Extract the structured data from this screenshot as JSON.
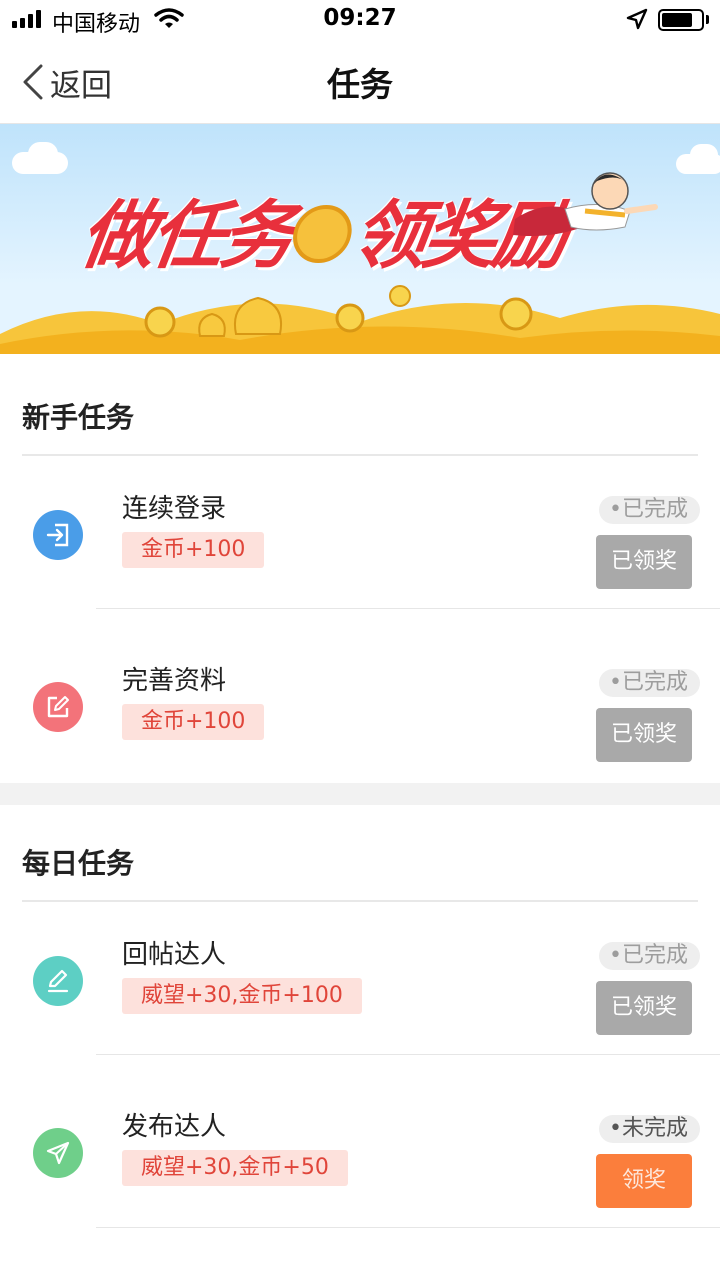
{
  "status_bar": {
    "carrier": "中国移动",
    "time": "09:27",
    "battery_level": 0.8
  },
  "nav": {
    "back_label": "返回",
    "title": "任务"
  },
  "banner": {
    "headline_left": "做任务",
    "headline_right": "领奖励"
  },
  "sections": [
    {
      "title": "新手任务",
      "tasks": [
        {
          "name": "连续登录",
          "reward": "金币+100",
          "status": "•已完成",
          "button": "已领奖",
          "icon": "login-icon",
          "icon_color": "#4a9de8"
        },
        {
          "name": "完善资料",
          "reward": "金币+100",
          "status": "•已完成",
          "button": "已领奖",
          "icon": "edit-icon",
          "icon_color": "#f3737a"
        }
      ]
    },
    {
      "title": "每日任务",
      "tasks": [
        {
          "name": "回帖达人",
          "reward": "威望+30,金币+100",
          "status": "•已完成",
          "button": "已领奖",
          "icon": "pencil-icon",
          "icon_color": "#5dcfc4"
        },
        {
          "name": "发布达人",
          "reward": "威望+30,金币+50",
          "status": "•未完成",
          "button": "领奖",
          "icon": "send-icon",
          "icon_color": "#6fcf8a"
        }
      ]
    }
  ],
  "colors": {
    "reward_bg": "#fde1dc",
    "reward_text": "#e0453a",
    "button_done": "#a9a9a9",
    "button_active": "#fb7e3c"
  }
}
